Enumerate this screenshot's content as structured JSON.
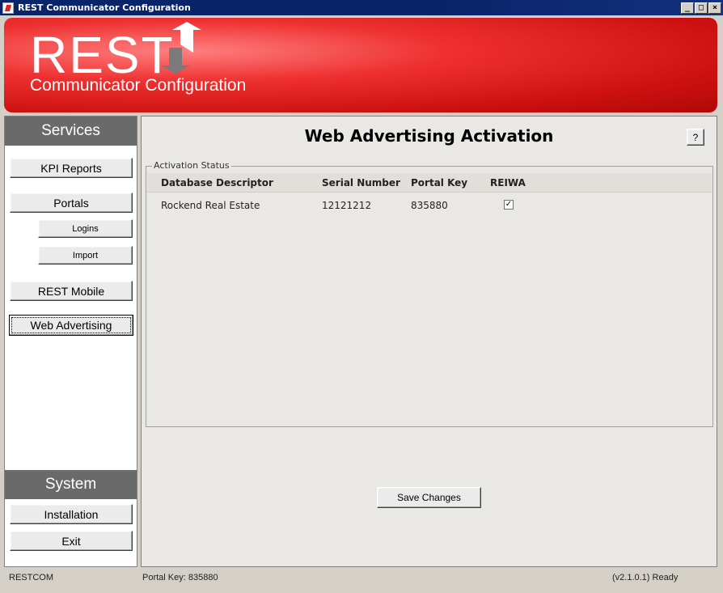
{
  "window": {
    "title": "REST Communicator Configuration",
    "buttons": [
      "_",
      "□",
      "×"
    ]
  },
  "banner": {
    "logo_text": "REST",
    "subtitle": "Communicator Configuration"
  },
  "sidebar": {
    "services_header": "Services",
    "items": [
      {
        "label": "KPI Reports"
      },
      {
        "label": "Portals"
      },
      {
        "label": "Logins"
      },
      {
        "label": "Import"
      },
      {
        "label": "REST Mobile"
      },
      {
        "label": "Web Advertising",
        "selected": true
      }
    ],
    "system_header": "System",
    "system_items": [
      {
        "label": "Installation"
      },
      {
        "label": "Exit"
      }
    ]
  },
  "main": {
    "title": "Web Advertising Activation",
    "help_label": "?",
    "group_label": "Activation Status",
    "columns": [
      "Database Descriptor",
      "Serial Number",
      "Portal Key",
      "REIWA"
    ],
    "rows": [
      {
        "database_descriptor": "Rockend Real Estate",
        "serial_number": "12121212",
        "portal_key": "835880",
        "reiwa_checked": true,
        "check_glyph": "✓"
      }
    ],
    "save_label": "Save Changes"
  },
  "statusbar": {
    "app": "RESTCOM",
    "portal_key": "Portal Key: 835880",
    "version": "(v2.1.0.1) Ready"
  },
  "colors": {
    "banner_red": "#cc1010",
    "title_bar": "#0a246a",
    "section_header": "#6a6a6a"
  }
}
